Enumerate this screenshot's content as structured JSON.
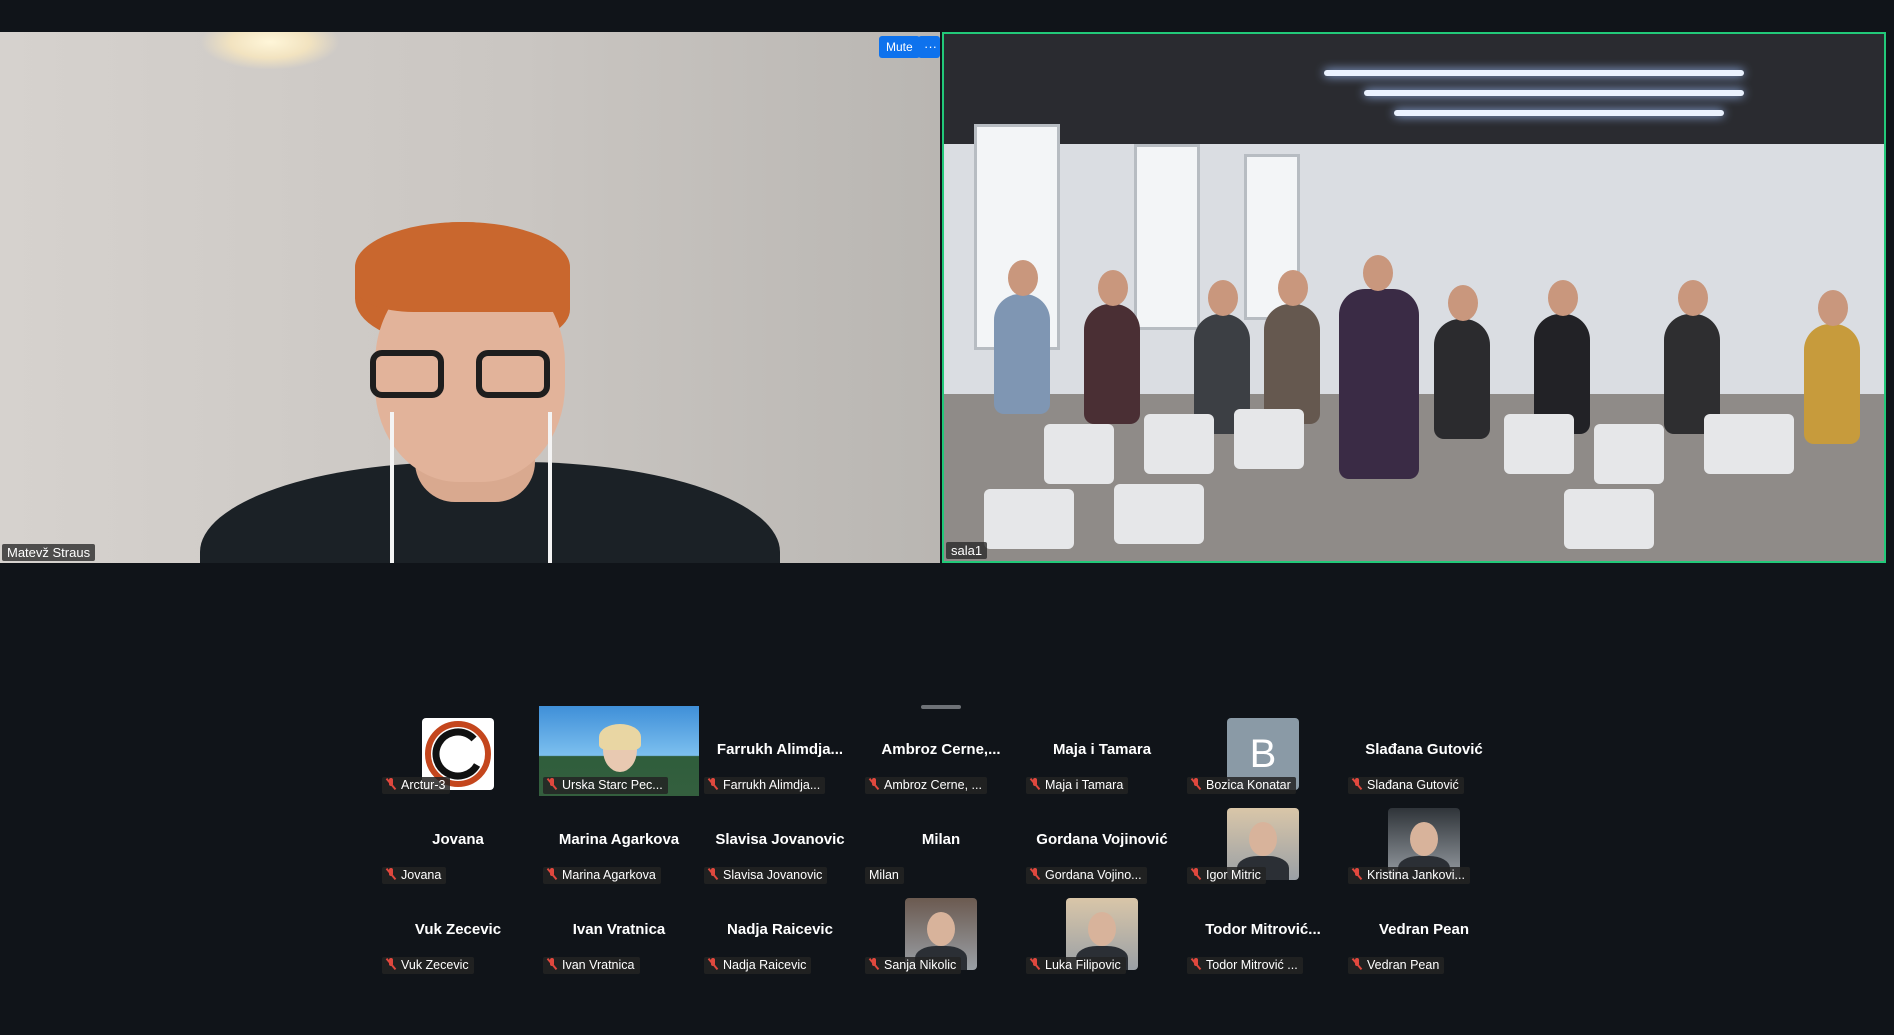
{
  "meeting": {
    "speaker_left": {
      "name": "Matevž Straus"
    },
    "speaker_right": {
      "name": "sala1"
    },
    "controls": {
      "mute_label": "Mute",
      "more_label": "···"
    }
  },
  "gallery": {
    "rows": [
      [
        {
          "title": "",
          "label": "Arctur-3",
          "muted": true,
          "avatar": "arctur-logo"
        },
        {
          "title": "",
          "label": "Urska Starc Pec...",
          "muted": true,
          "avatar": "video"
        },
        {
          "title": "Farrukh  Alimdja...",
          "label": "Farrukh Alimdja...",
          "muted": true
        },
        {
          "title": "Ambroz  Cerne,...",
          "label": "Ambroz Cerne, ...",
          "muted": true
        },
        {
          "title": "Maja i Tamara",
          "label": "Maja i Tamara",
          "muted": true
        },
        {
          "title": "",
          "label": "Bozica Konatar",
          "muted": true,
          "avatar": "letter-b",
          "avatar_letter": "B"
        },
        {
          "title": "Slađana Gutović",
          "label": "Slađana Gutović",
          "muted": true
        }
      ],
      [
        {
          "title": "Jovana",
          "label": "Jovana",
          "muted": true
        },
        {
          "title": "Marina Agarkova",
          "label": "Marina Agarkova",
          "muted": true
        },
        {
          "title": "Slavisa Jovanovic",
          "label": "Slavisa Jovanovic",
          "muted": true
        },
        {
          "title": "Milan",
          "label": "Milan",
          "muted": false
        },
        {
          "title": "Gordana Vojinović",
          "label": "Gordana Vojino...",
          "muted": true
        },
        {
          "title": "",
          "label": "Igor Mitric",
          "muted": true,
          "avatar": "photo"
        },
        {
          "title": "",
          "label": "Kristina Jankovi...",
          "muted": true,
          "avatar": "photo"
        }
      ],
      [
        {
          "title": "Vuk Zecevic",
          "label": "Vuk Zecevic",
          "muted": true
        },
        {
          "title": "Ivan Vratnica",
          "label": "Ivan Vratnica",
          "muted": true
        },
        {
          "title": "Nadja Raicevic",
          "label": "Nadja Raicevic",
          "muted": true
        },
        {
          "title": "",
          "label": "Sanja Nikolic",
          "muted": true,
          "avatar": "photo"
        },
        {
          "title": "",
          "label": "Luka Filipovic",
          "muted": true,
          "avatar": "photo"
        },
        {
          "title": "Todor  Mitrović...",
          "label": "Todor Mitrović ...",
          "muted": true
        },
        {
          "title": "Vedran Pean",
          "label": "Vedran Pean",
          "muted": true
        }
      ]
    ]
  },
  "colors": {
    "active_speaker_border": "#22c979",
    "mute_button": "#0e72ed",
    "mic_off": "#e0483e",
    "background": "#101419"
  }
}
